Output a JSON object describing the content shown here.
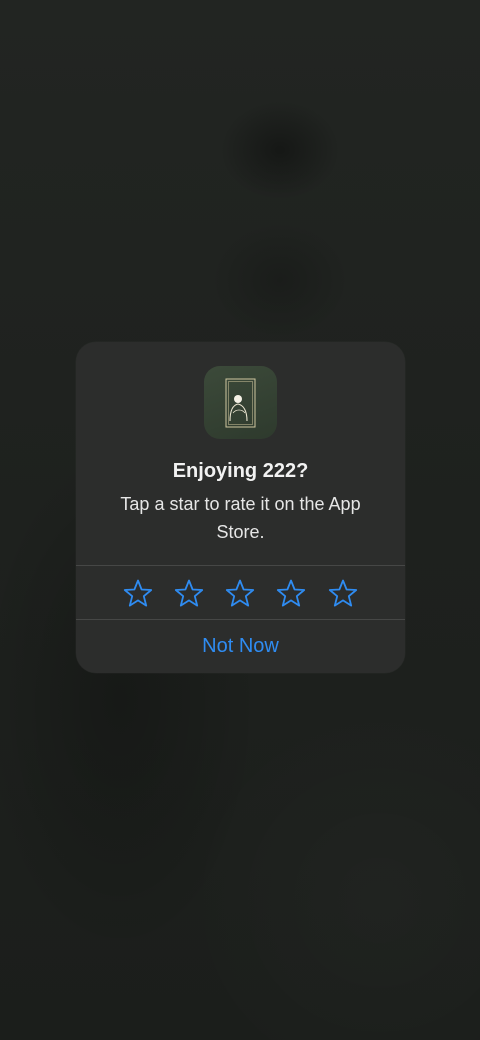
{
  "alert": {
    "title": "Enjoying 222?",
    "message": "Tap a star to rate it on the App Store.",
    "stars": [
      {
        "icon": "star-outline-icon",
        "rating": 1
      },
      {
        "icon": "star-outline-icon",
        "rating": 2
      },
      {
        "icon": "star-outline-icon",
        "rating": 3
      },
      {
        "icon": "star-outline-icon",
        "rating": 4
      },
      {
        "icon": "star-outline-icon",
        "rating": 5
      }
    ],
    "dismiss_label": "Not Now",
    "app_icon": "portrait-in-frame-icon"
  },
  "colors": {
    "accent": "#2f8cf2",
    "alert_bg": "#2c2d2c",
    "backdrop": "#1d201d",
    "divider": "#464746"
  }
}
